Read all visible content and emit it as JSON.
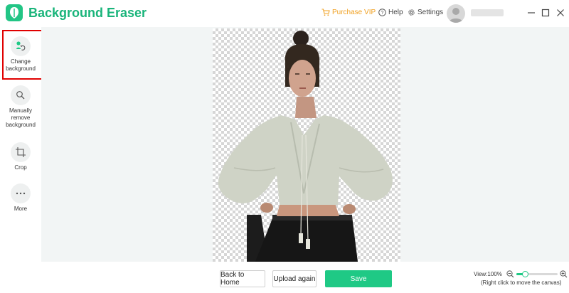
{
  "window": {
    "title": "Background Eraser",
    "purchase_vip": "Purchase VIP",
    "help": "Help",
    "settings": "Settings",
    "accent_color": "#19b47a",
    "vip_color": "#f0a020"
  },
  "sidebar": {
    "items": [
      {
        "label_lines": [
          "Change",
          "background"
        ],
        "icon": "change-background-icon",
        "selected": true
      },
      {
        "label_lines": [
          "Manually",
          "remove",
          "background"
        ],
        "icon": "manual-erase-icon",
        "selected": false
      },
      {
        "label_lines": [
          "Crop"
        ],
        "icon": "crop-icon",
        "selected": false
      },
      {
        "label_lines": [
          "More"
        ],
        "icon": "more-dots-icon",
        "selected": false
      }
    ],
    "highlight_color": "#e00000"
  },
  "footer": {
    "back_home": "Back to Home",
    "upload_again": "Upload again",
    "save": "Save",
    "zoom_label": "View:100%",
    "zoom_hint": "(Right click to move the canvas)",
    "zoom_percent": 100,
    "save_color": "#1fc985"
  }
}
